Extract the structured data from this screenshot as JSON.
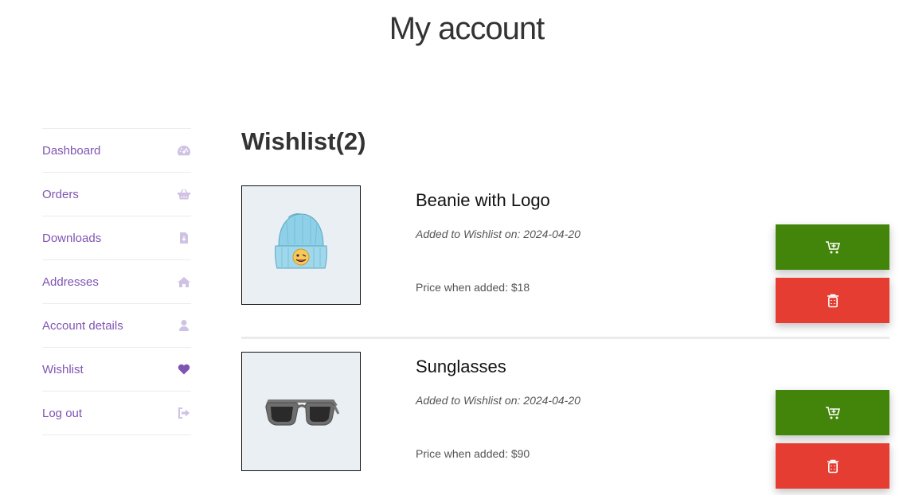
{
  "page": {
    "title": "My account"
  },
  "sidebar": {
    "items": [
      {
        "label": "Dashboard",
        "icon": "dashboard-gauge-icon"
      },
      {
        "label": "Orders",
        "icon": "basket-icon"
      },
      {
        "label": "Downloads",
        "icon": "file-download-icon"
      },
      {
        "label": "Addresses",
        "icon": "home-icon"
      },
      {
        "label": "Account details",
        "icon": "user-icon"
      },
      {
        "label": "Wishlist",
        "icon": "heart-icon"
      },
      {
        "label": "Log out",
        "icon": "sign-out-icon"
      }
    ]
  },
  "wishlist": {
    "heading": "Wishlist(2)",
    "items": [
      {
        "name": "Beanie with Logo",
        "added": "Added to Wishlist on: 2024-04-20",
        "price": "Price when added: $18",
        "image_icon": "beanie-image"
      },
      {
        "name": "Sunglasses",
        "added": "Added to Wishlist on: 2024-04-20",
        "price": "Price when added: $90",
        "image_icon": "sunglasses-image"
      }
    ],
    "add_to_cart_icon": "cart-plus-icon",
    "remove_icon": "trash-icon"
  },
  "colors": {
    "accent_purple": "#7f54b3",
    "icon_muted": "#cfc2e3",
    "cart_green": "#43850a",
    "delete_red": "#e63d32"
  }
}
